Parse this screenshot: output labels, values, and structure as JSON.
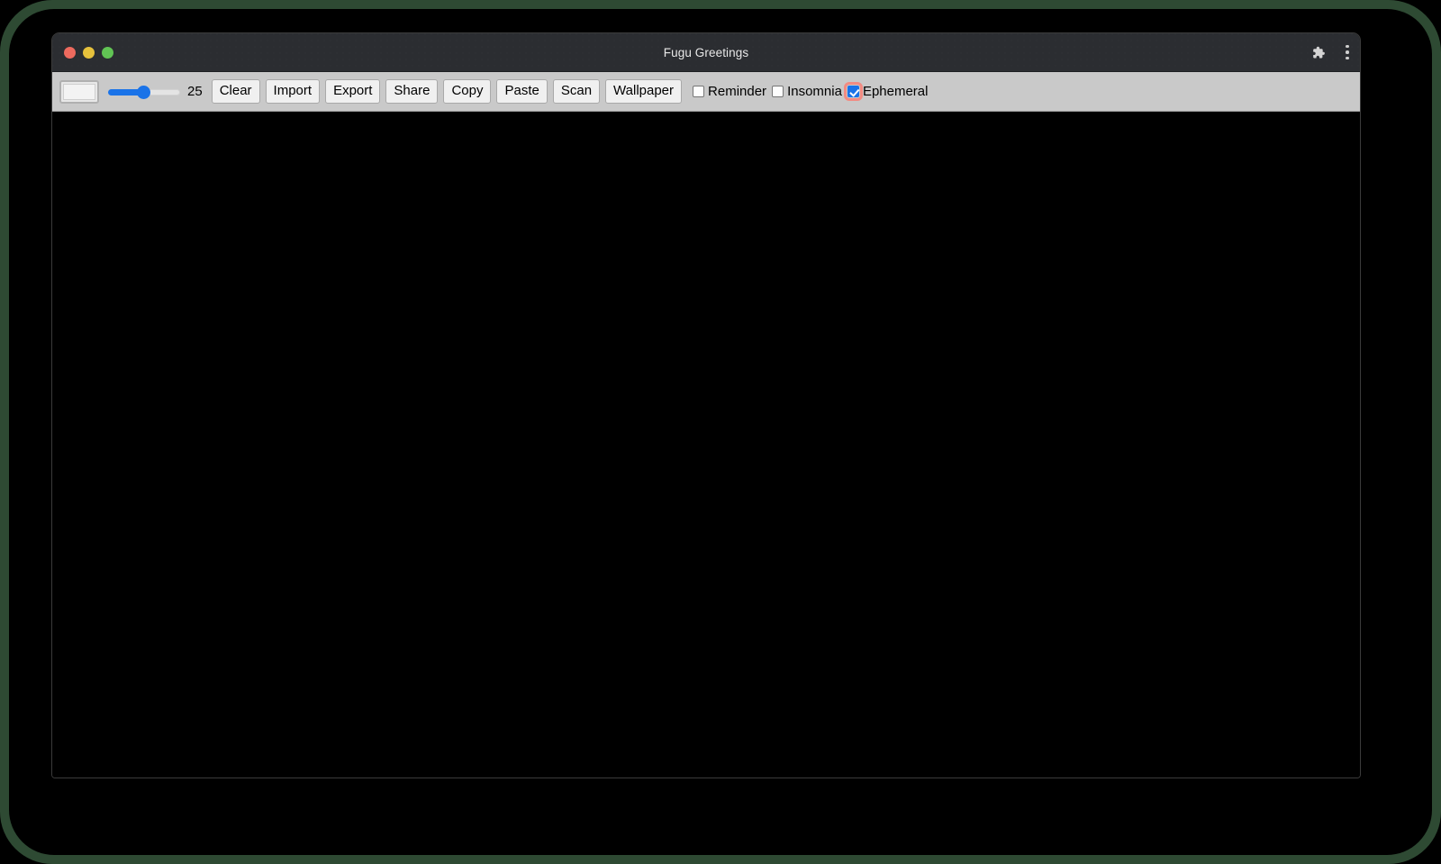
{
  "window": {
    "title": "Fugu Greetings",
    "traffic_lights": [
      {
        "name": "close",
        "color": "#ed6a5e"
      },
      {
        "name": "minimize",
        "color": "#e6c13c"
      },
      {
        "name": "maximize",
        "color": "#61c454"
      }
    ],
    "extensions_icon": "puzzle-piece-icon",
    "menu_icon": "three-dot-vertical-menu-icon"
  },
  "toolbar": {
    "color_picker": {
      "icon": "color-swatch-icon",
      "value": "#f3f3f3"
    },
    "thickness": {
      "value": "25",
      "min": "1",
      "max": "50",
      "percent": 48
    },
    "buttons": [
      {
        "label": "Clear"
      },
      {
        "label": "Import"
      },
      {
        "label": "Export"
      },
      {
        "label": "Share"
      },
      {
        "label": "Copy"
      },
      {
        "label": "Paste"
      },
      {
        "label": "Scan"
      },
      {
        "label": "Wallpaper"
      }
    ],
    "checkboxes": [
      {
        "label": "Reminder",
        "checked": false,
        "focused": false
      },
      {
        "label": "Insomnia",
        "checked": false,
        "focused": false
      },
      {
        "label": "Ephemeral",
        "checked": true,
        "focused": true
      }
    ]
  },
  "canvas": {
    "name": "drawing-canvas",
    "background": "#000000",
    "content": ""
  },
  "colors": {
    "accent": "#1a73e8",
    "toolbar_bg": "#c9c9c9",
    "titlebar_bg": "#2b2d31",
    "focus_ring": "#f28b82",
    "desktop_bg": "#2e4a33"
  }
}
